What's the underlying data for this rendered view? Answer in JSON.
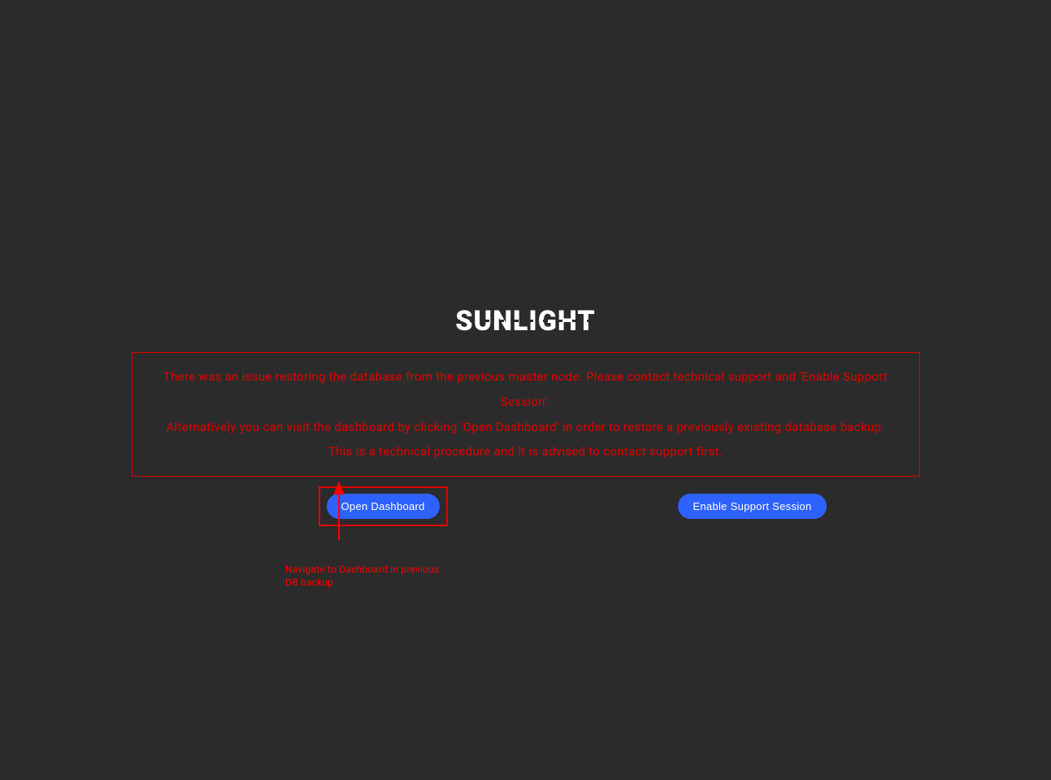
{
  "brand": {
    "name": "SUNLIGHT"
  },
  "alert": {
    "line1": "There was an issue restoring the database from the previous master node. Please contact technical support and 'Enable Support Session'.",
    "line2": "Alternatively you can visit the dashboard by clicking 'Open Dashboard' in order to restore a previously existing database backup.",
    "line3": "This is a technical procedure and it is advised to contact support first."
  },
  "buttons": {
    "open_dashboard": "Open Dashboard",
    "enable_support": "Enable Support Session"
  },
  "annotation": {
    "text": "Navigate to Dashboard in previous DB backup"
  },
  "colors": {
    "background": "#2b2b2b",
    "alert_border": "#e50000",
    "alert_text": "#e50000",
    "button_bg": "#2e62ff",
    "button_text": "#ffffff",
    "annotation": "#ff0000"
  }
}
